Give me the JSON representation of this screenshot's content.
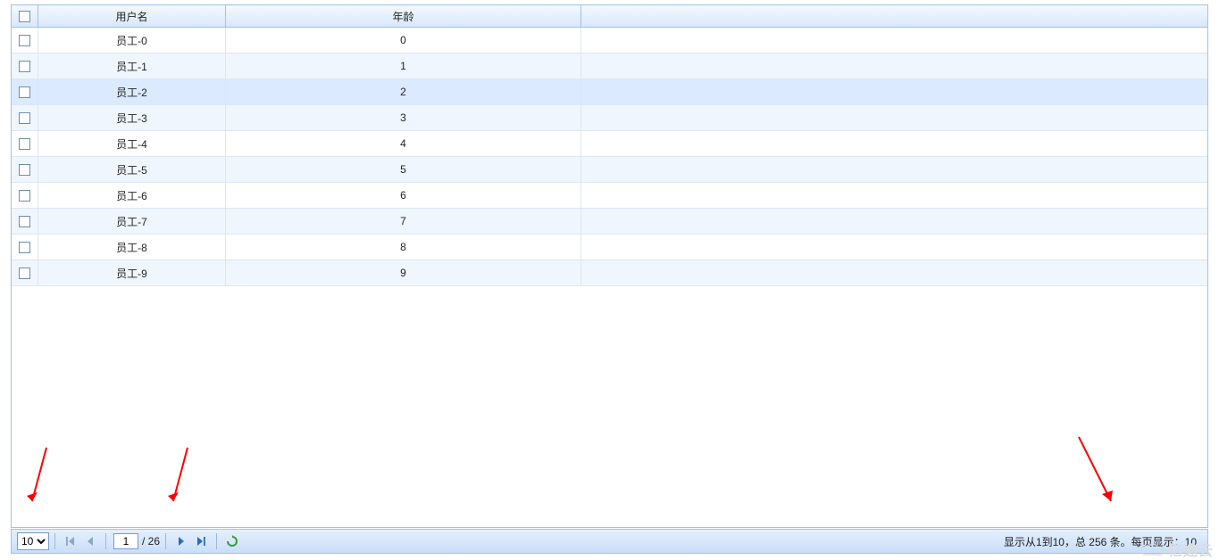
{
  "columns": {
    "username": "用户名",
    "age": "年龄"
  },
  "rows": [
    {
      "username": "员工-0",
      "age": "0",
      "selected": false
    },
    {
      "username": "员工-1",
      "age": "1",
      "selected": false
    },
    {
      "username": "员工-2",
      "age": "2",
      "selected": true
    },
    {
      "username": "员工-3",
      "age": "3",
      "selected": false
    },
    {
      "username": "员工-4",
      "age": "4",
      "selected": false
    },
    {
      "username": "员工-5",
      "age": "5",
      "selected": false
    },
    {
      "username": "员工-6",
      "age": "6",
      "selected": false
    },
    {
      "username": "员工-7",
      "age": "7",
      "selected": false
    },
    {
      "username": "员工-8",
      "age": "8",
      "selected": false
    },
    {
      "username": "员工-9",
      "age": "9",
      "selected": false
    }
  ],
  "pager": {
    "page_size_value": "10",
    "page_size_options": [
      "10"
    ],
    "current_page": "1",
    "total_pages_label": "/ 26",
    "info": "显示从1到10，总 256 条。每页显示：10"
  },
  "watermark": "亿速云",
  "icons": {
    "first": "first-icon",
    "prev": "prev-icon",
    "next": "next-icon",
    "last": "last-icon",
    "refresh": "refresh-icon"
  }
}
